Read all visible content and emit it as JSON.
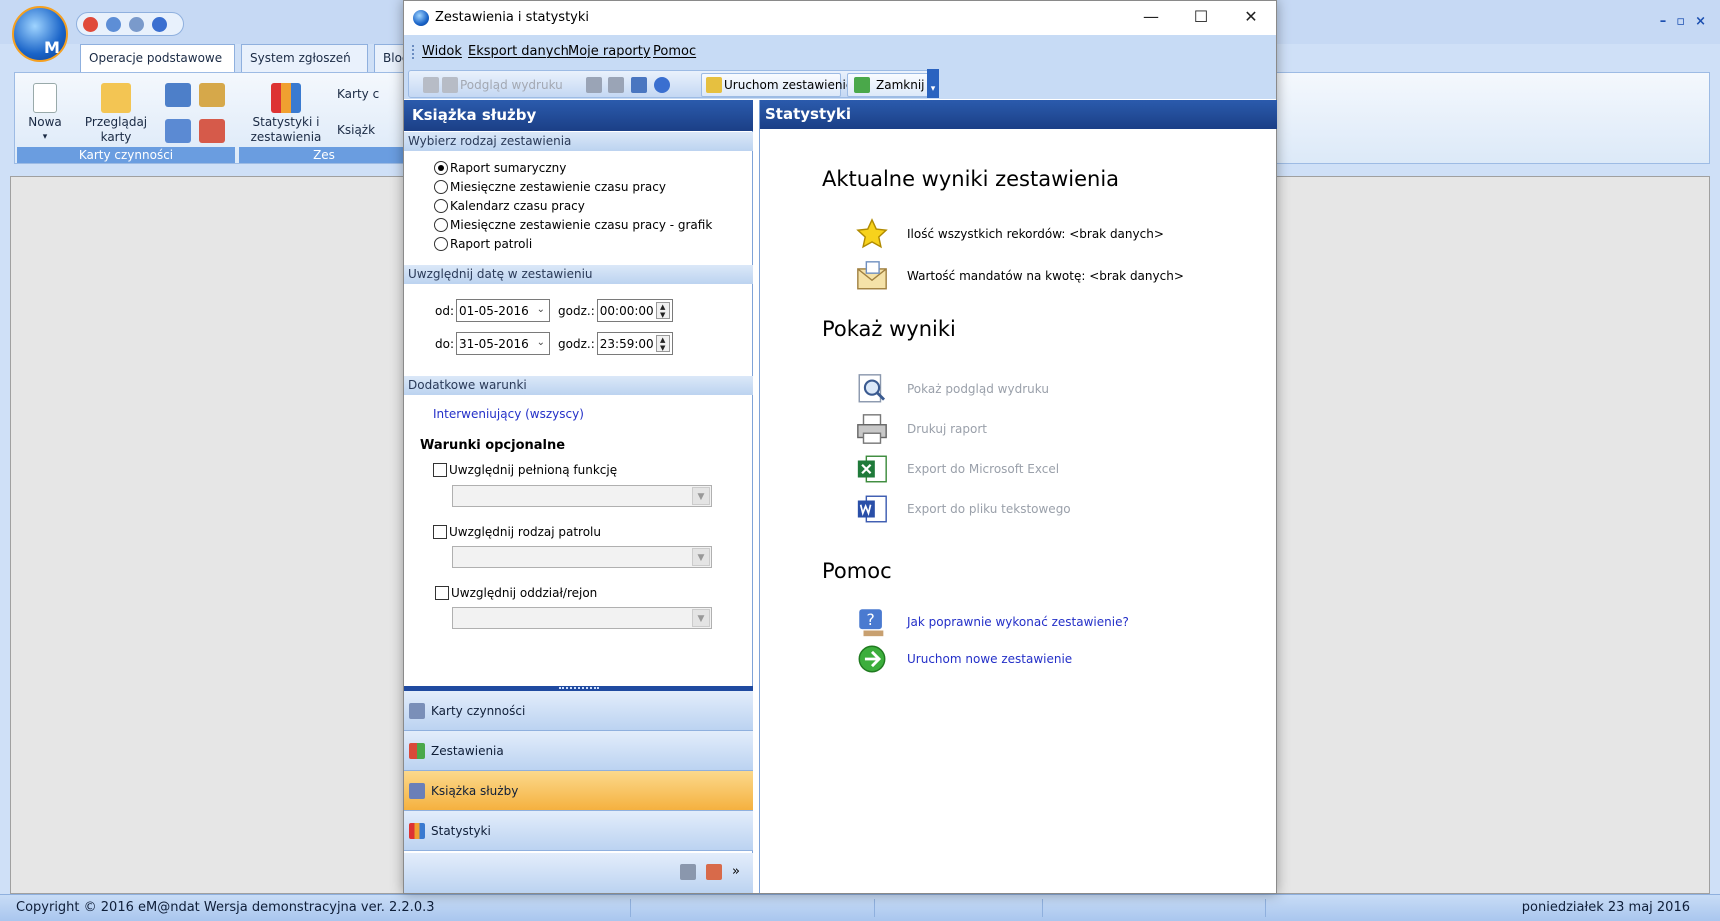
{
  "background_app": {
    "tabs": [
      "Operacje podstawowe",
      "System zgłoszeń",
      "Bloc"
    ],
    "ribbon": {
      "new_label": "Nowa",
      "browse_label_1": "Przeglądaj",
      "browse_label_2": "karty",
      "stats_label_1": "Statystyki i",
      "stats_label_2": "zestawienia",
      "cards_partial": "Karty c",
      "book_partial": "Książk",
      "group_cards": "Karty czynności",
      "group_z": "Zes"
    },
    "window_buttons": [
      "–",
      "▫",
      "×"
    ],
    "status": {
      "copyright": "Copyright © 2016 eM@ndat  Wersja demonstracyjna   ver. 2.2.0.3",
      "date": "poniedziałek 23 maj 2016"
    }
  },
  "dialog": {
    "title": "Zestawienia i statystyki",
    "menu": [
      "Widok",
      "Eksport danych",
      "Moje raporty",
      "Pomoc"
    ],
    "toolbar": {
      "print_preview": "Podgląd wydruku",
      "run_report": "Uruchom zestawienie",
      "close": "Zamknij"
    },
    "left": {
      "header": "Książka służby",
      "section_type": "Wybierz rodzaj zestawienia",
      "report_types": [
        "Raport sumaryczny",
        "Miesięczne zestawienie czasu pracy",
        "Kalendarz czasu pracy",
        "Miesięczne zestawienie czasu pracy - grafik",
        "Raport patroli"
      ],
      "selected_report": 0,
      "section_date": "Uwzględnij datę w zestawieniu",
      "from_label": "od:",
      "from_date": "01-05-2016",
      "to_label": "do:",
      "to_date": "31-05-2016",
      "time_label": "godz.:",
      "from_time": "00:00:00",
      "to_time": "23:59:00",
      "section_extra": "Dodatkowe warunki",
      "intervener_link": "Interweniujący  (wszyscy)",
      "optional_heading": "Warunki opcjonalne",
      "optional_checks": [
        "Uwzględnij pełnioną funkcję",
        "Uwzględnij rodzaj patrolu",
        "Uwzględnij oddział/rejon"
      ],
      "nav": [
        "Karty czynności",
        "Zestawienia",
        "Książka służby",
        "Statystyki"
      ],
      "nav_active": 2
    },
    "right": {
      "header": "Statystyki",
      "current_heading": "Aktualne wyniki zestawienia",
      "records_label": "Ilość wszystkich rekordów:  <brak danych>",
      "fines_label": "Wartość mandatów na kwotę:  <brak danych>",
      "show_heading": "Pokaż wyniki",
      "show_actions": [
        "Pokaż podgląd wydruku",
        "Drukuj raport",
        "Export do Microsoft Excel",
        "Export do pliku tekstowego"
      ],
      "help_heading": "Pomoc",
      "help_links": [
        "Jak poprawnie wykonać zestawienie?",
        "Uruchom nowe zestawienie"
      ]
    }
  }
}
